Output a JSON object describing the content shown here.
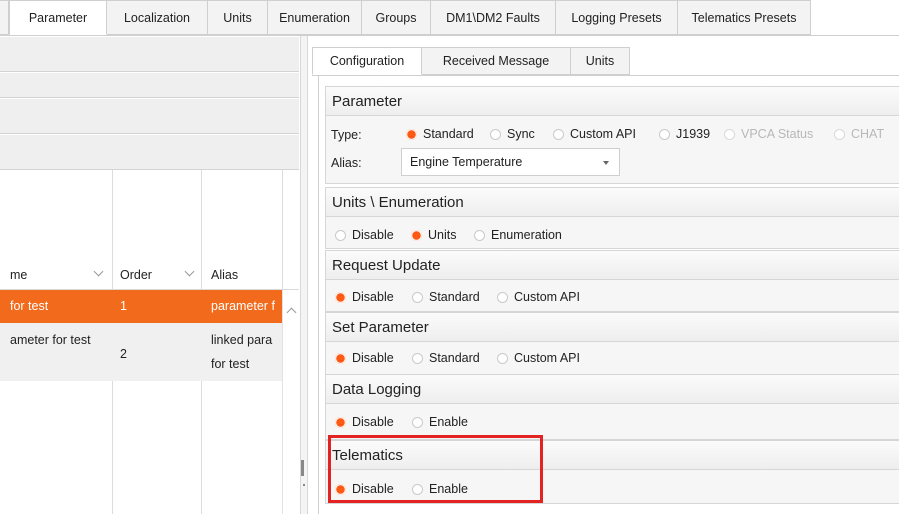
{
  "top_tabs": [
    "Parameter",
    "Localization",
    "Units",
    "Enumeration",
    "Groups",
    "DM1\\DM2 Faults",
    "Logging Presets",
    "Telematics Presets"
  ],
  "left_grid": {
    "headers": {
      "name": "me",
      "order": "Order",
      "alias": "Alias"
    },
    "rows": [
      {
        "name": "for test",
        "order": "1",
        "alias": "parameter f",
        "selected": true
      },
      {
        "name": "ameter for test",
        "order": "2",
        "alias_line1": "linked para",
        "alias_line2": "for test"
      }
    ]
  },
  "sub_tabs": [
    "Configuration",
    "Received Message",
    "Units"
  ],
  "sections": {
    "parameter": {
      "title": "Parameter",
      "type_label": "Type:",
      "type_options": [
        "Standard",
        "Sync",
        "Custom API",
        "J1939",
        "VPCA Status",
        "CHAT"
      ],
      "type_selected": "Standard",
      "alias_label": "Alias:",
      "alias_value": "Engine Temperature"
    },
    "units_enum": {
      "title": "Units \\ Enumeration",
      "options": [
        "Disable",
        "Units",
        "Enumeration"
      ],
      "selected": "Units"
    },
    "request_update": {
      "title": "Request Update",
      "options": [
        "Disable",
        "Standard",
        "Custom API"
      ],
      "selected": "Disable"
    },
    "set_parameter": {
      "title": "Set Parameter",
      "options": [
        "Disable",
        "Standard",
        "Custom API"
      ],
      "selected": "Disable"
    },
    "data_logging": {
      "title": "Data Logging",
      "options": [
        "Disable",
        "Enable"
      ],
      "selected": "Disable"
    },
    "telematics": {
      "title": "Telematics",
      "options": [
        "Disable",
        "Enable"
      ],
      "selected": "Disable"
    }
  },
  "colors": {
    "selection": "#f26a1b",
    "radio_on": "#ff5a14",
    "highlight": "#e32222"
  }
}
